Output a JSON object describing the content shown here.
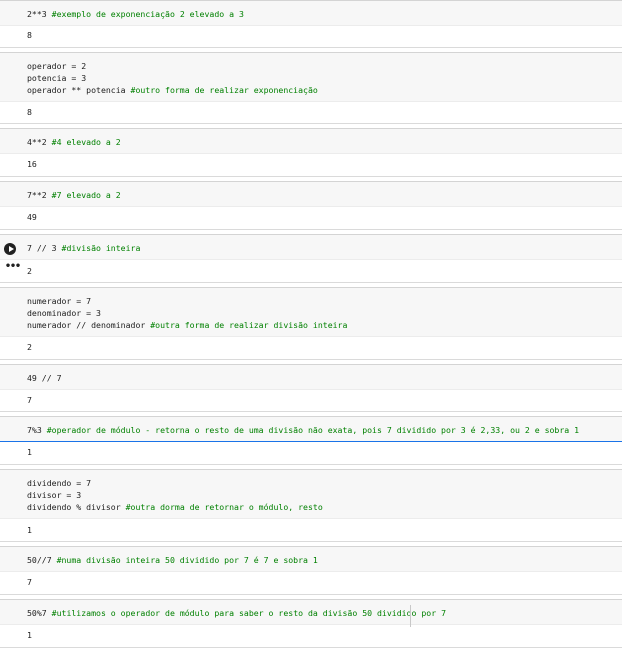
{
  "cells": [
    {
      "lines": [
        {
          "code": "2**3 ",
          "comment": "#exemplo de exponenciação 2 elevado a 3"
        }
      ],
      "output": "8"
    },
    {
      "lines": [
        {
          "code": "operador = 2",
          "comment": ""
        },
        {
          "code": "potencia = 3",
          "comment": ""
        },
        {
          "code": "operador ** potencia ",
          "comment": "#outro forma de realizar exponenciação"
        }
      ],
      "output": "8"
    },
    {
      "lines": [
        {
          "code": "4**2 ",
          "comment": "#4 elevado a 2"
        }
      ],
      "output": "16"
    },
    {
      "lines": [
        {
          "code": "7**2 ",
          "comment": "#7 elevado a 2"
        }
      ],
      "output": "49"
    },
    {
      "lines": [
        {
          "code": "7 // 3 ",
          "comment": "#divisão inteira"
        }
      ],
      "output": "2"
    },
    {
      "lines": [
        {
          "code": "numerador = 7",
          "comment": ""
        },
        {
          "code": "denominador = 3",
          "comment": ""
        },
        {
          "code": "numerador // denominador ",
          "comment": "#outra forma de realizar divisão inteira"
        }
      ],
      "output": "2"
    },
    {
      "lines": [
        {
          "code": "49 // 7",
          "comment": ""
        }
      ],
      "output": "7"
    },
    {
      "lines": [
        {
          "code": "7%3 ",
          "comment": "#operador de módulo - retorna o resto de uma divisão não exata, pois 7 dividido por 3 é 2,33, ou 2 e sobra 1"
        }
      ],
      "output": "1"
    },
    {
      "lines": [
        {
          "code": "dividendo = 7",
          "comment": ""
        },
        {
          "code": "divisor = 3",
          "comment": ""
        },
        {
          "code": "dividendo % divisor ",
          "comment": "#outra dorma de retornar o módulo, resto"
        }
      ],
      "output": "1"
    },
    {
      "lines": [
        {
          "code": "50//7 ",
          "comment": "#numa divisão inteira 50 dividido por 7 é 7 e sobra 1"
        }
      ],
      "output": "7"
    },
    {
      "lines": [
        {
          "code": "50%7 ",
          "comment": "#utilizamos o operador de módulo para saber o resto da divisão 50 dividido por 7"
        }
      ],
      "output": "1"
    }
  ],
  "icons": {
    "run_button": "play-circle-icon",
    "output_menu": "more-horizontal-icon"
  }
}
